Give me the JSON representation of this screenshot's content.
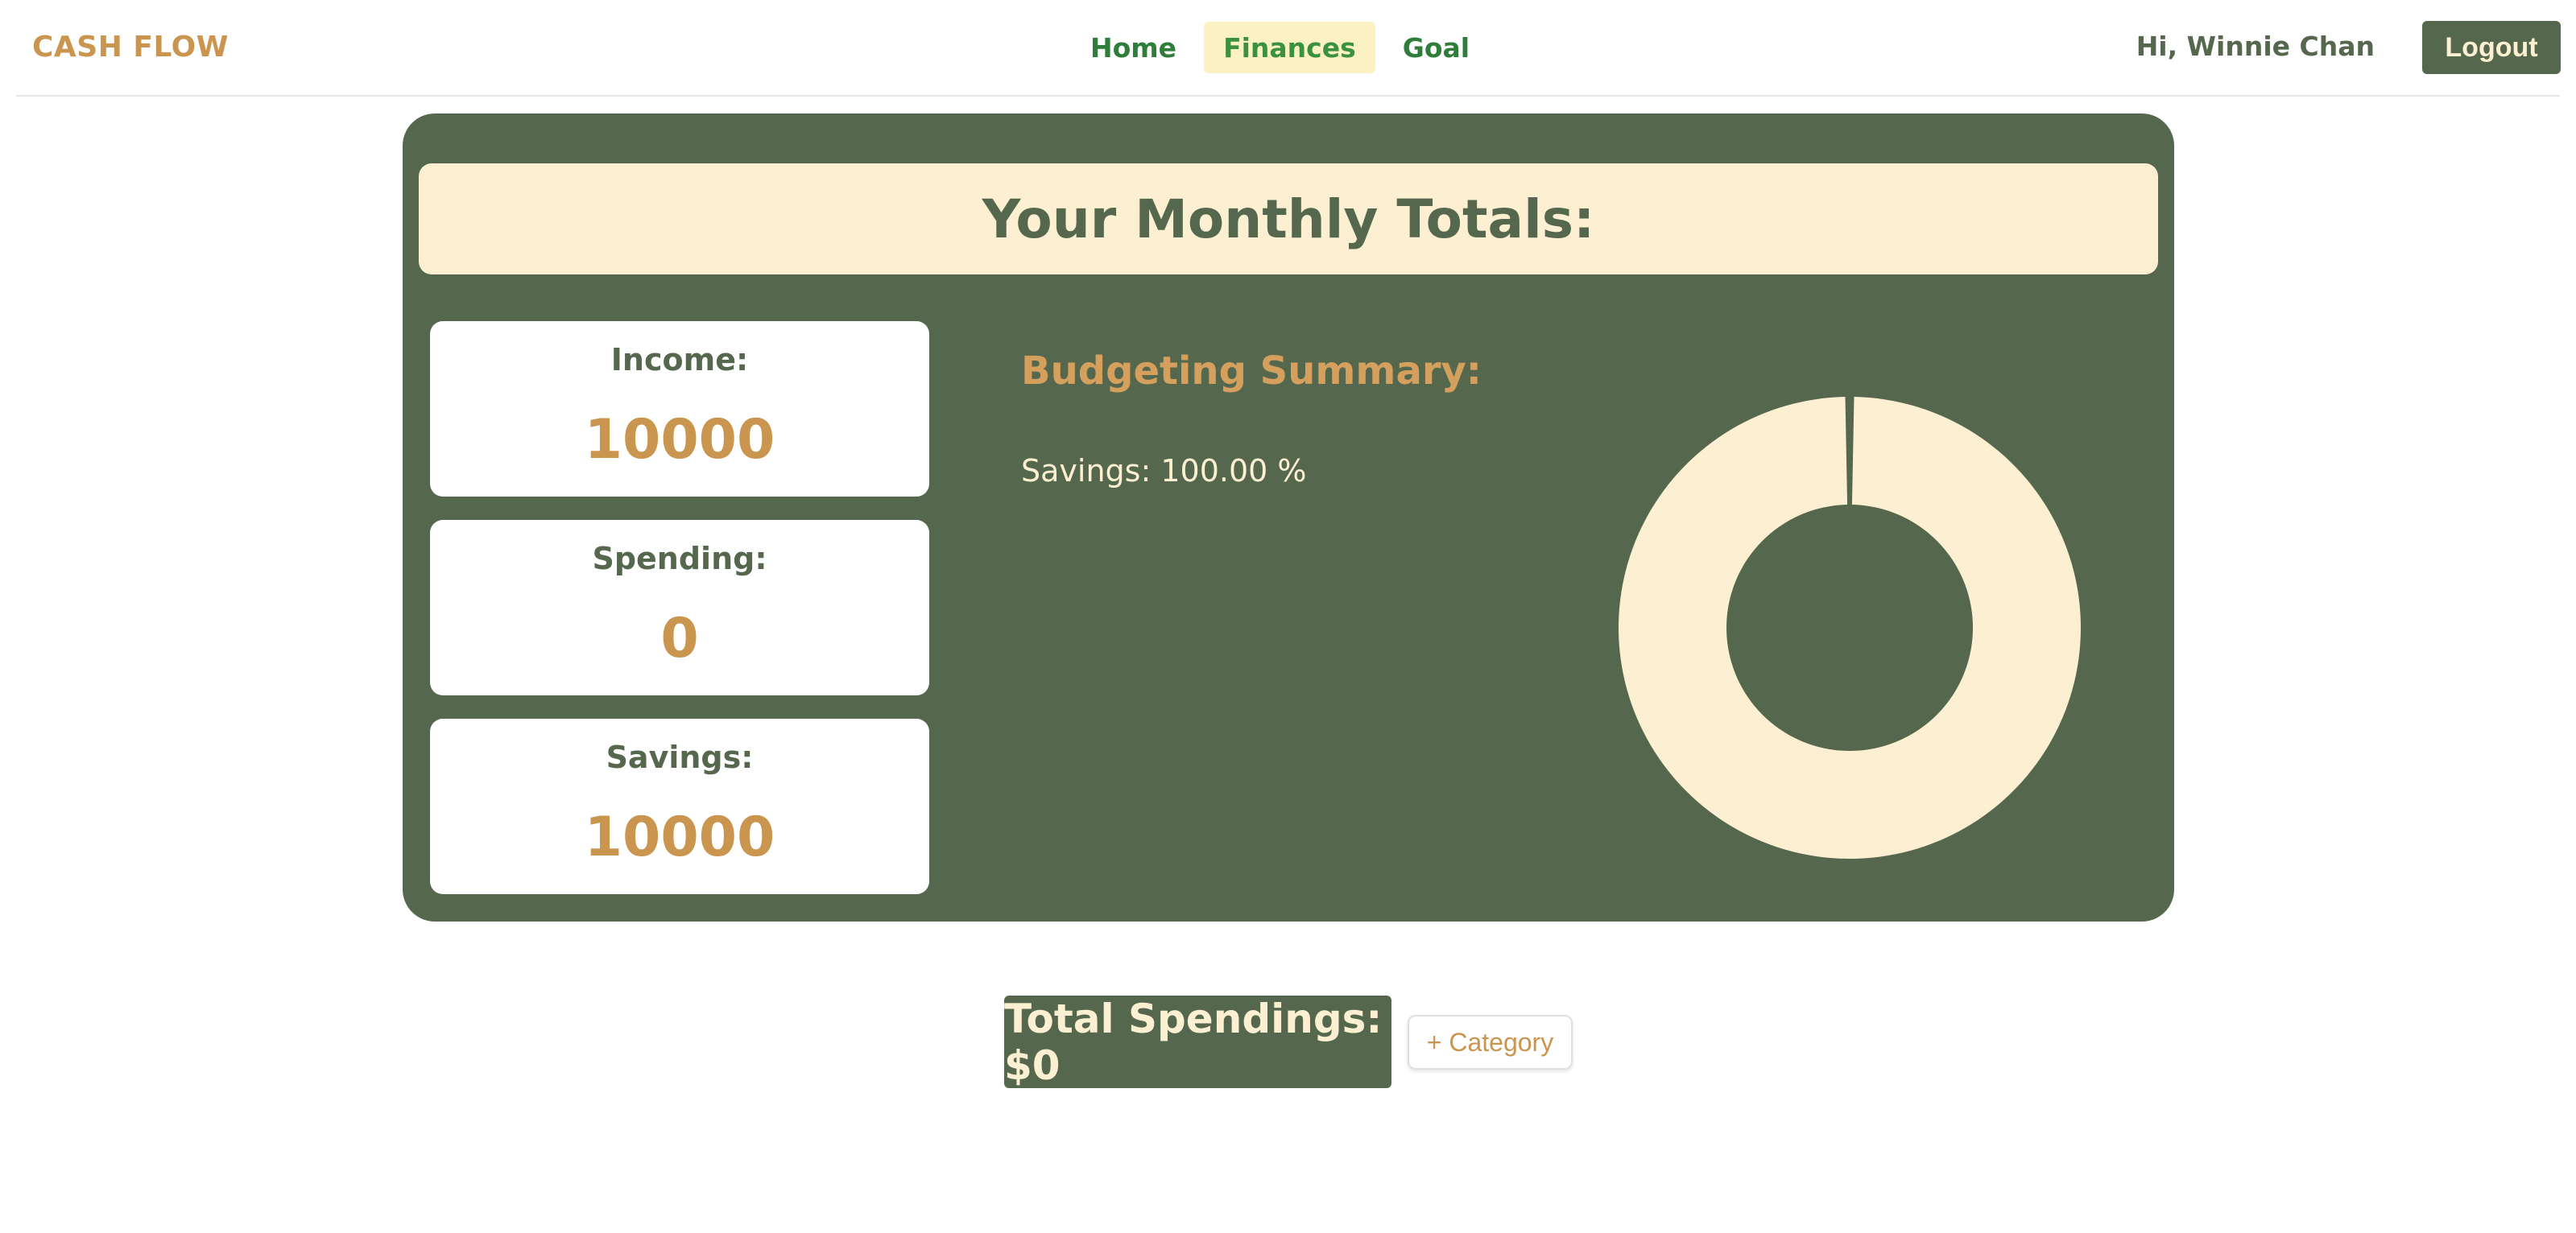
{
  "nav": {
    "brand": "CASH FLOW",
    "links": [
      {
        "label": "Home",
        "active": false
      },
      {
        "label": "Finances",
        "active": true
      },
      {
        "label": "Goal",
        "active": false
      }
    ],
    "greeting": "Hi, Winnie Chan",
    "logout_label": "Logout"
  },
  "totals": {
    "heading": "Your Monthly Totals:",
    "cards": [
      {
        "label": "Income:",
        "value": "10000"
      },
      {
        "label": "Spending:",
        "value": "0"
      },
      {
        "label": "Savings:",
        "value": "10000"
      }
    ]
  },
  "summary": {
    "title": "Budgeting Summary:",
    "lines": [
      "Savings: 100.00 %"
    ]
  },
  "chart_data": {
    "type": "pie",
    "categories": [
      "Savings"
    ],
    "values": [
      100
    ],
    "colors": [
      "#fdf0d2"
    ],
    "style": "donut"
  },
  "footer": {
    "total_spendings": "Total Spendings: $0",
    "add_category_label": "+ Category"
  },
  "colors": {
    "primary_green": "#55684e",
    "cream": "#fdf0d2",
    "accent_gold": "#c9954f",
    "nav_active_bg": "#fcf1c2"
  }
}
